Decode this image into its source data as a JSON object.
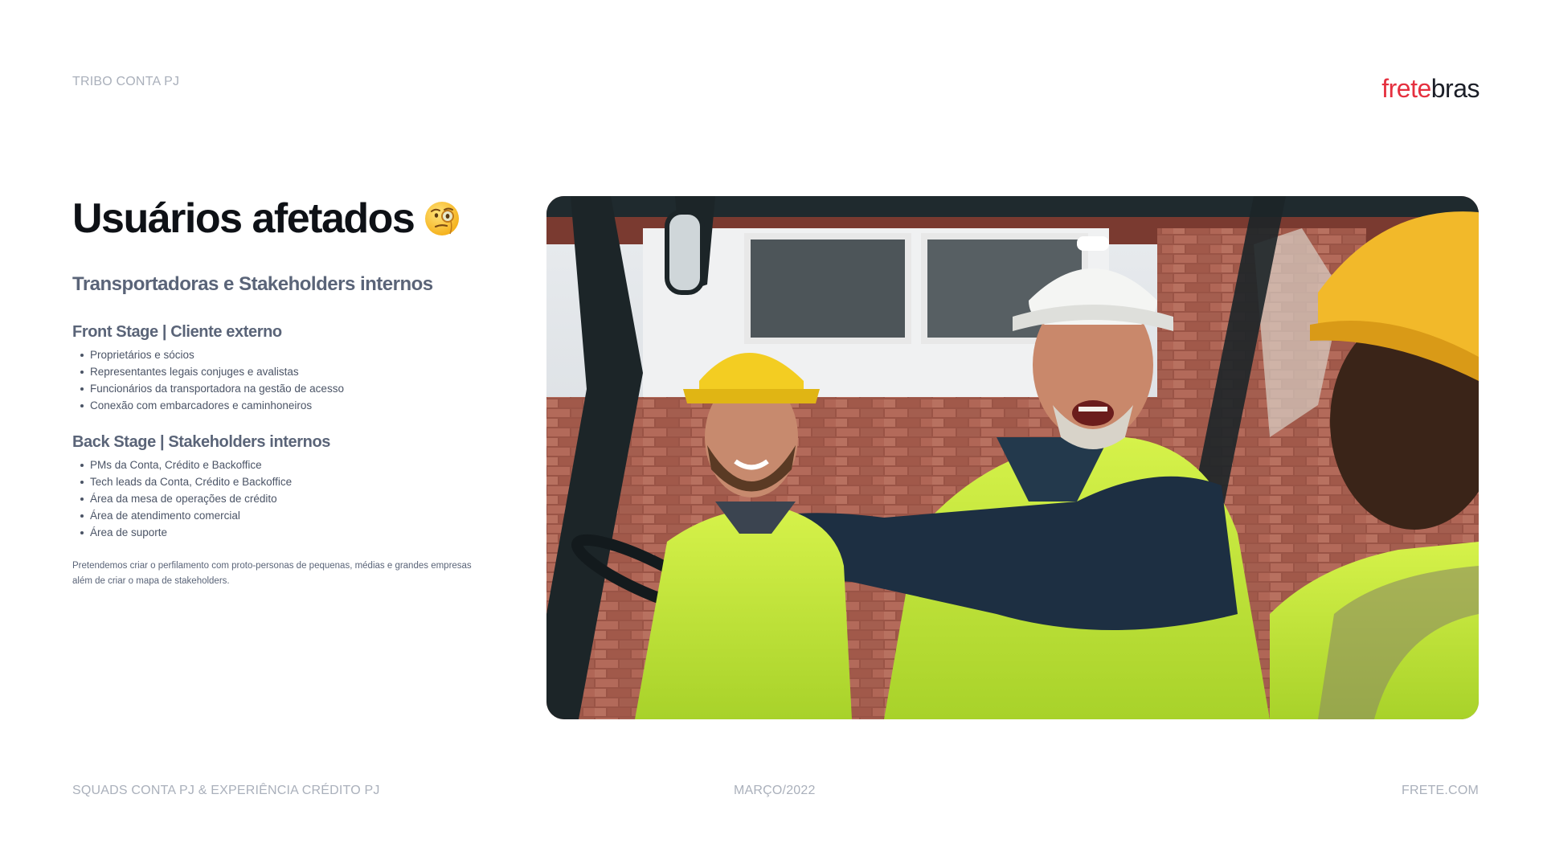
{
  "header": {
    "tribe": "TRIBO CONTA PJ",
    "logo_part1": "frete",
    "logo_part2": "bras"
  },
  "title": "Usuários afetados",
  "title_emoji_icon": "face-with-monocle-icon",
  "subtitle": "Transportadoras e Stakeholders internos",
  "front_stage": {
    "heading": "Front Stage | Cliente externo",
    "items": [
      "Proprietários e sócios",
      "Representantes legais conjuges e avalistas",
      "Funcionários da transportadora na gestão de acesso",
      "Conexão com embarcadores e caminhoneiros"
    ]
  },
  "back_stage": {
    "heading": "Back Stage | Stakeholders internos",
    "items": [
      "PMs da Conta, Crédito e Backoffice",
      "Tech leads da Conta, Crédito e Backoffice",
      "Área da mesa de operações de crédito",
      "Área de atendimento comercial",
      "Área de suporte"
    ]
  },
  "note": {
    "line1": "Pretendemos criar o perfilamento com proto-personas de pequenas, médias e grandes empresas",
    "line2": "além de criar o mapa de stakeholders."
  },
  "footer": {
    "left": "SQUADS CONTA PJ & EXPERIÊNCIA CRÉDITO PJ",
    "center": "MARÇO/2022",
    "right": "FRETE.COM"
  },
  "colors": {
    "brand_red": "#e5303f",
    "brand_dark": "#1b1e27",
    "muted": "#aab0bb",
    "heading_gray": "#5a6478"
  }
}
